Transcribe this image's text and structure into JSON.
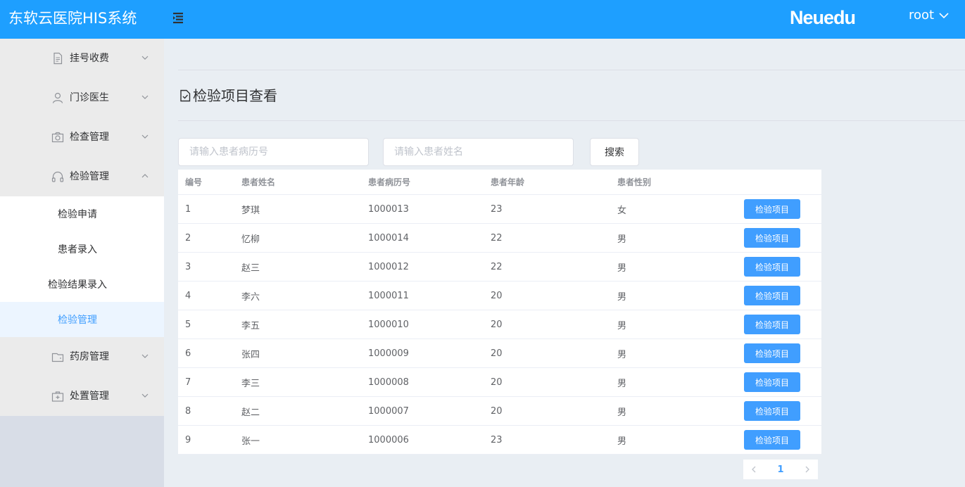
{
  "header": {
    "app_title": "东软云医院HIS系统",
    "brand": "Neuedu",
    "user": "root",
    "bg_color": "#1e9fff"
  },
  "sidebar": {
    "groups": [
      {
        "label": "挂号收费",
        "icon": "document-icon",
        "expanded": false
      },
      {
        "label": "门诊医生",
        "icon": "user-icon",
        "expanded": false
      },
      {
        "label": "检查管理",
        "icon": "camera-icon",
        "expanded": false
      },
      {
        "label": "检验管理",
        "icon": "headphones-icon",
        "expanded": true
      },
      {
        "label": "药房管理",
        "icon": "wallet-icon",
        "expanded": false
      },
      {
        "label": "处置管理",
        "icon": "first-aid-icon",
        "expanded": false
      }
    ],
    "sub_items": [
      {
        "label": "检验申请",
        "active": false
      },
      {
        "label": "患者录入",
        "active": false
      },
      {
        "label": "检验结果录入",
        "active": false
      },
      {
        "label": "检验管理",
        "active": true
      }
    ]
  },
  "main": {
    "page_title": "检验项目查看",
    "search": {
      "record_placeholder": "请输入患者病历号",
      "name_placeholder": "请输入患者姓名",
      "button": "搜索"
    },
    "table": {
      "columns": [
        "编号",
        "患者姓名",
        "患者病历号",
        "患者年龄",
        "患者性别"
      ],
      "action_label": "检验项目",
      "rows": [
        [
          "1",
          "梦琪",
          "1000013",
          "23",
          "女"
        ],
        [
          "2",
          "忆柳",
          "1000014",
          "22",
          "男"
        ],
        [
          "3",
          "赵三",
          "1000012",
          "22",
          "男"
        ],
        [
          "4",
          "李六",
          "1000011",
          "20",
          "男"
        ],
        [
          "5",
          "李五",
          "1000010",
          "20",
          "男"
        ],
        [
          "6",
          "张四",
          "1000009",
          "20",
          "男"
        ],
        [
          "7",
          "李三",
          "1000008",
          "20",
          "男"
        ],
        [
          "8",
          "赵二",
          "1000007",
          "20",
          "男"
        ],
        [
          "9",
          "张一",
          "1000006",
          "23",
          "男"
        ]
      ]
    },
    "pagination": {
      "current": "1",
      "prev_icon": "chevron-left-icon",
      "next_icon": "chevron-right-icon"
    }
  },
  "colors": {
    "accent": "#409eff",
    "active_bg": "#ecf5ff"
  }
}
